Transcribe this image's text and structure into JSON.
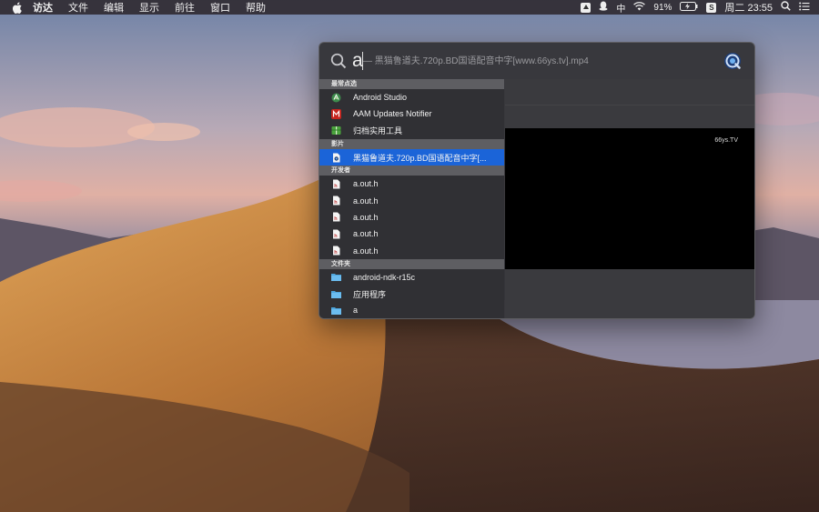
{
  "menubar": {
    "app_name": "访达",
    "items": [
      "文件",
      "编辑",
      "显示",
      "前往",
      "窗口",
      "帮助"
    ],
    "status": {
      "ime": "中",
      "battery": "91%",
      "clock": "周二 23:55"
    }
  },
  "spotlight": {
    "query": "a",
    "completion": "— 黑猫鲁道夫.720p.BD国语配音中字[www.66ys.tv].mp4",
    "sections": [
      {
        "header": "最常点选",
        "items": [
          {
            "label": "Android Studio",
            "icon": "android-studio-icon"
          },
          {
            "label": "AAM Updates Notifier",
            "icon": "adobe-icon"
          },
          {
            "label": "归档实用工具",
            "icon": "archive-utility-icon"
          }
        ]
      },
      {
        "header": "影片",
        "items": [
          {
            "label": "黑猫鲁道夫.720p.BD国语配音中字[...",
            "icon": "movie-file-icon",
            "selected": true
          }
        ]
      },
      {
        "header": "开发者",
        "items": [
          {
            "label": "a.out.h",
            "icon": "header-file-icon"
          },
          {
            "label": "a.out.h",
            "icon": "header-file-icon"
          },
          {
            "label": "a.out.h",
            "icon": "header-file-icon"
          },
          {
            "label": "a.out.h",
            "icon": "header-file-icon"
          },
          {
            "label": "a.out.h",
            "icon": "header-file-icon"
          }
        ]
      },
      {
        "header": "文件夹",
        "items": [
          {
            "label": "android-ndk-r15c",
            "icon": "folder-icon"
          },
          {
            "label": "应用程序",
            "icon": "folder-icon"
          },
          {
            "label": "a",
            "icon": "folder-icon"
          }
        ]
      }
    ],
    "preview": {
      "watermark": "66ys.TV"
    }
  },
  "colors": {
    "selection": "#1b64d8",
    "panel": "#343438",
    "section_header": "#5e5e62"
  }
}
